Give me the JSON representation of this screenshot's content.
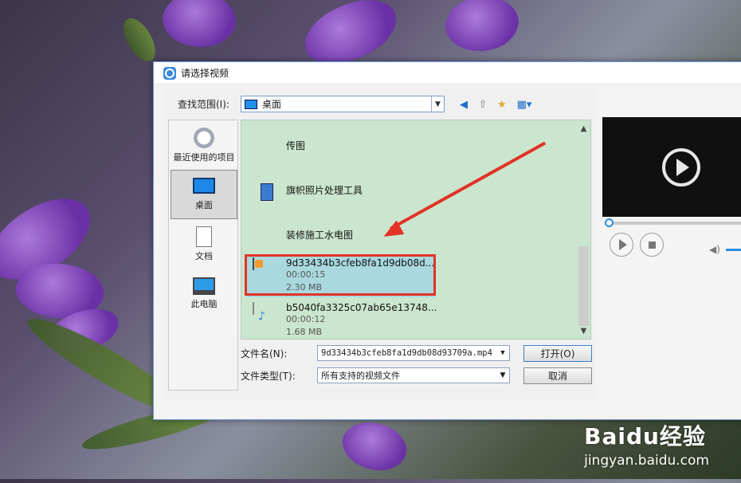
{
  "window": {
    "title": "请选择视频"
  },
  "lookin": {
    "label": "查找范围(I):",
    "value": "桌面"
  },
  "places": [
    {
      "label": "最近使用的项目",
      "icon": "recent-icon"
    },
    {
      "label": "桌面",
      "icon": "desktop-icon"
    },
    {
      "label": "文档",
      "icon": "documents-icon"
    },
    {
      "label": "此电脑",
      "icon": "computer-icon"
    }
  ],
  "files": [
    {
      "name": "传图",
      "type": "folder"
    },
    {
      "name": "旗帜照片处理工具",
      "type": "folder"
    },
    {
      "name": "装修施工水电图",
      "type": "folder"
    },
    {
      "name": "9d33434b3cfeb8fa1d9db08d...",
      "duration": "00:00:15",
      "size": "2.30 MB",
      "type": "video",
      "selected": true
    },
    {
      "name": "b5040fa3325c07ab65e13748...",
      "duration": "00:00:12",
      "size": "1.68 MB",
      "type": "audio"
    }
  ],
  "filename": {
    "label": "文件名(N):",
    "value": "9d33434b3cfeb8fa1d9db08d93709a.mp4"
  },
  "filetype": {
    "label": "文件类型(T):",
    "value": "所有支持的视频文件"
  },
  "buttons": {
    "open": "打开(O)",
    "cancel": "取消"
  },
  "watermark": {
    "logo": "Baidu经验",
    "url": "jingyan.baidu.com"
  },
  "colors": {
    "list_bg": "#cbe6cf",
    "selection": "#a9d9df",
    "highlight": "#e23326",
    "accent": "#2a8fe0"
  }
}
